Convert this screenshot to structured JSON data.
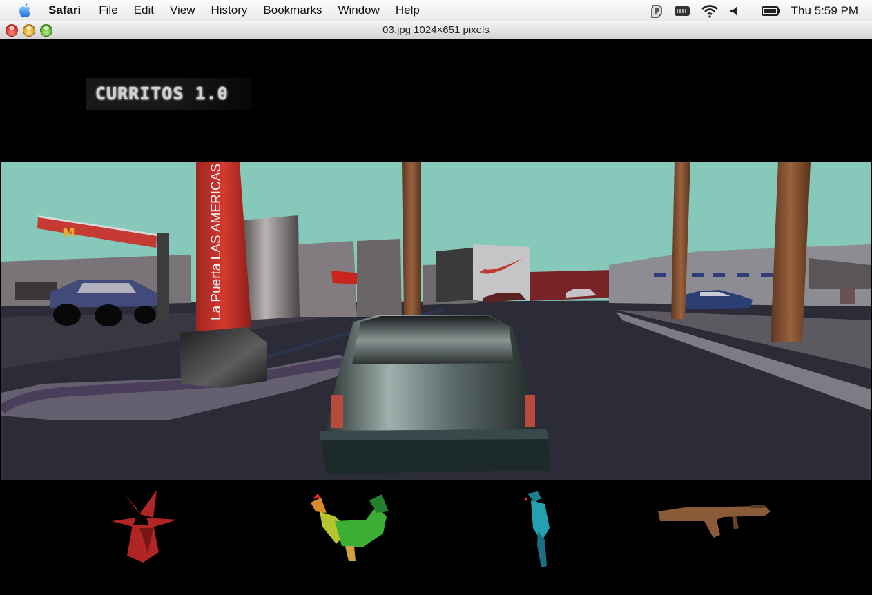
{
  "menubar": {
    "app_name": "Safari",
    "items": [
      "File",
      "Edit",
      "View",
      "History",
      "Bookmarks",
      "Window",
      "Help"
    ],
    "clock": "Thu 5:59 PM",
    "status_icons": [
      "script-menu-icon",
      "keyboard-icon",
      "wifi-icon",
      "volume-icon",
      "battery-icon"
    ]
  },
  "window": {
    "title": "03.jpg 1024×651 pixels"
  },
  "game": {
    "title": "CURRITOS 1.0",
    "signs": {
      "pillar": "La Puerta LAS AMERICAS",
      "billboard_logo": "M"
    },
    "inventory": [
      "devil-icon",
      "rooster-icon",
      "parrot-icon",
      "rifle-icon"
    ]
  },
  "colors": {
    "sky": "#86c8b9",
    "road": "#2a2a38",
    "pillar_red": "#c8322b",
    "pole_brown": "#7a4a2e"
  }
}
